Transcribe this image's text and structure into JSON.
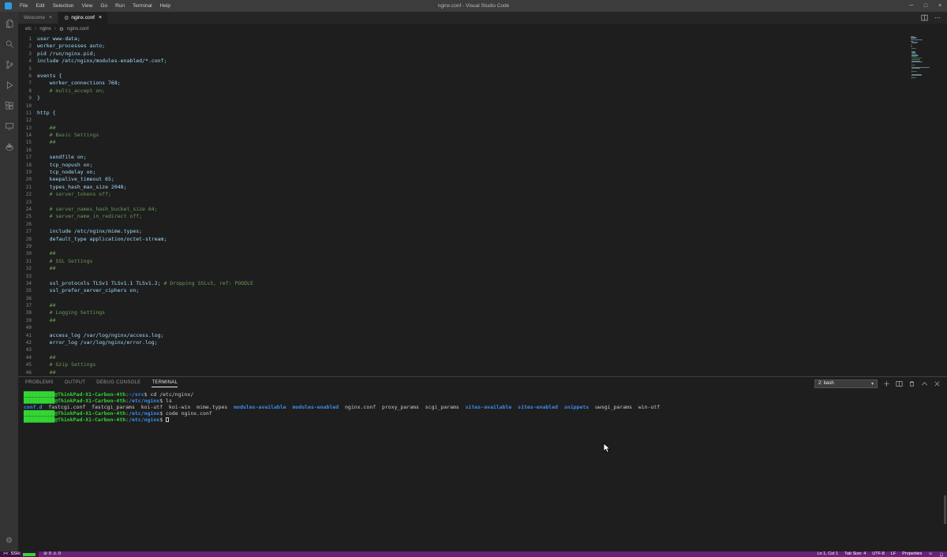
{
  "window": {
    "title": "nginx.conf - Visual Studio Code",
    "menu": [
      "File",
      "Edit",
      "Selection",
      "View",
      "Go",
      "Run",
      "Terminal",
      "Help"
    ],
    "controls": {
      "minimize": "─",
      "maximize": "□",
      "close": "×"
    }
  },
  "icons": {
    "gear": "⚙",
    "chevron_down": "▾",
    "more": "⋯",
    "remote": "><",
    "smiley": "☺"
  },
  "editor_tabs": [
    {
      "label": "Welcome",
      "close": "×"
    },
    {
      "label": "nginx.conf",
      "icon": "⚙",
      "close": "×"
    }
  ],
  "breadcrumb": {
    "items": [
      "etc",
      "nginx",
      "nginx.conf"
    ],
    "separator": "›"
  },
  "editor": {
    "lines": [
      {
        "n": 1,
        "s": [
          {
            "t": "user www-data;",
            "c": "code"
          }
        ]
      },
      {
        "n": 2,
        "s": [
          {
            "t": "worker_processes auto;",
            "c": "code"
          }
        ]
      },
      {
        "n": 3,
        "s": [
          {
            "t": "pid /run/nginx.pid;",
            "c": "code"
          }
        ]
      },
      {
        "n": 4,
        "s": [
          {
            "t": "include /etc/nginx/modules-enabled/*.conf;",
            "c": "code"
          }
        ]
      },
      {
        "n": 5,
        "s": []
      },
      {
        "n": 6,
        "s": [
          {
            "t": "events {",
            "c": "code"
          }
        ]
      },
      {
        "n": 7,
        "s": [
          {
            "t": "\tworker_connections 768;",
            "c": "code"
          }
        ]
      },
      {
        "n": 8,
        "s": [
          {
            "t": "\t# multi_accept on;",
            "c": "comment"
          }
        ]
      },
      {
        "n": 9,
        "s": [
          {
            "t": "}",
            "c": "code"
          }
        ]
      },
      {
        "n": 10,
        "s": []
      },
      {
        "n": 11,
        "s": [
          {
            "t": "http {",
            "c": "code"
          }
        ]
      },
      {
        "n": 12,
        "s": []
      },
      {
        "n": 13,
        "s": [
          {
            "t": "\t##",
            "c": "comment"
          }
        ]
      },
      {
        "n": 14,
        "s": [
          {
            "t": "\t# Basic Settings",
            "c": "comment"
          }
        ]
      },
      {
        "n": 15,
        "s": [
          {
            "t": "\t##",
            "c": "comment"
          }
        ]
      },
      {
        "n": 16,
        "s": []
      },
      {
        "n": 17,
        "s": [
          {
            "t": "\tsendfile on;",
            "c": "code"
          }
        ]
      },
      {
        "n": 18,
        "s": [
          {
            "t": "\ttcp_nopush on;",
            "c": "code"
          }
        ]
      },
      {
        "n": 19,
        "s": [
          {
            "t": "\ttcp_nodelay on;",
            "c": "code"
          }
        ]
      },
      {
        "n": 20,
        "s": [
          {
            "t": "\tkeepalive_timeout 65;",
            "c": "code"
          }
        ]
      },
      {
        "n": 21,
        "s": [
          {
            "t": "\ttypes_hash_max_size 2048;",
            "c": "code"
          }
        ]
      },
      {
        "n": 22,
        "s": [
          {
            "t": "\t# server_tokens off;",
            "c": "comment"
          }
        ]
      },
      {
        "n": 23,
        "s": []
      },
      {
        "n": 24,
        "s": [
          {
            "t": "\t# server_names_hash_bucket_size 64;",
            "c": "comment"
          }
        ]
      },
      {
        "n": 25,
        "s": [
          {
            "t": "\t# server_name_in_redirect off;",
            "c": "comment"
          }
        ]
      },
      {
        "n": 26,
        "s": []
      },
      {
        "n": 27,
        "s": [
          {
            "t": "\tinclude /etc/nginx/mime.types;",
            "c": "code"
          }
        ]
      },
      {
        "n": 28,
        "s": [
          {
            "t": "\tdefault_type application/octet-stream;",
            "c": "code"
          }
        ]
      },
      {
        "n": 29,
        "s": []
      },
      {
        "n": 30,
        "s": [
          {
            "t": "\t##",
            "c": "comment"
          }
        ]
      },
      {
        "n": 31,
        "s": [
          {
            "t": "\t# SSL Settings",
            "c": "comment"
          }
        ]
      },
      {
        "n": 32,
        "s": [
          {
            "t": "\t##",
            "c": "comment"
          }
        ]
      },
      {
        "n": 33,
        "s": []
      },
      {
        "n": 34,
        "s": [
          {
            "t": "\tssl_protocols TLSv1 TLSv1.1 TLSv1.2; ",
            "c": "code"
          },
          {
            "t": "# Dropping SSLv3, ref: POODLE",
            "c": "comment"
          }
        ]
      },
      {
        "n": 35,
        "s": [
          {
            "t": "\tssl_prefer_server_ciphers on;",
            "c": "code"
          }
        ]
      },
      {
        "n": 36,
        "s": []
      },
      {
        "n": 37,
        "s": [
          {
            "t": "\t##",
            "c": "comment"
          }
        ]
      },
      {
        "n": 38,
        "s": [
          {
            "t": "\t# Logging Settings",
            "c": "comment"
          }
        ]
      },
      {
        "n": 39,
        "s": [
          {
            "t": "\t##",
            "c": "comment"
          }
        ]
      },
      {
        "n": 40,
        "s": []
      },
      {
        "n": 41,
        "s": [
          {
            "t": "\taccess_log /var/log/nginx/access.log;",
            "c": "code"
          }
        ]
      },
      {
        "n": 42,
        "s": [
          {
            "t": "\terror_log /var/log/nginx/error.log;",
            "c": "code"
          }
        ]
      },
      {
        "n": 43,
        "s": []
      },
      {
        "n": 44,
        "s": [
          {
            "t": "\t##",
            "c": "comment"
          }
        ]
      },
      {
        "n": 45,
        "s": [
          {
            "t": "\t# Gzip Settings",
            "c": "comment"
          }
        ]
      },
      {
        "n": 46,
        "s": [
          {
            "t": "\t##",
            "c": "comment"
          }
        ]
      }
    ]
  },
  "panel": {
    "tabs": [
      "PROBLEMS",
      "OUTPUT",
      "DEBUG CONSOLE",
      "TERMINAL"
    ],
    "active_tab": "TERMINAL",
    "shell_selector": "2: bash",
    "terminal_lines": [
      {
        "s": [
          {
            "t": "██████████@ThinkPad-X1-Carbon-4th",
            "c": "prompt"
          },
          {
            "t": ":",
            "c": "plain"
          },
          {
            "t": "~/src",
            "c": "path"
          },
          {
            "t": "$ ",
            "c": "plain"
          },
          {
            "t": "cd /etc/nginx/",
            "c": "plain"
          }
        ]
      },
      {
        "s": [
          {
            "t": "██████████@ThinkPad-X1-Carbon-4th",
            "c": "prompt"
          },
          {
            "t": ":",
            "c": "plain"
          },
          {
            "t": "/etc/nginx",
            "c": "path"
          },
          {
            "t": "$ ",
            "c": "plain"
          },
          {
            "t": "ls",
            "c": "plain"
          }
        ]
      },
      {
        "s": [
          {
            "t": "conf.d",
            "c": "dir"
          },
          {
            "t": "  fastcgi.conf  fastcgi_params  koi-utf  koi-win  mime.types  ",
            "c": "plain"
          },
          {
            "t": "modules-available",
            "c": "dir"
          },
          {
            "t": "  ",
            "c": "plain"
          },
          {
            "t": "modules-enabled",
            "c": "dir"
          },
          {
            "t": "  nginx.conf  proxy_params  scgi_params  ",
            "c": "plain"
          },
          {
            "t": "sites-available",
            "c": "dir"
          },
          {
            "t": "  ",
            "c": "plain"
          },
          {
            "t": "sites-enabled",
            "c": "dir"
          },
          {
            "t": "  ",
            "c": "plain"
          },
          {
            "t": "snippets",
            "c": "dir"
          },
          {
            "t": "  uwsgi_params  win-utf",
            "c": "plain"
          }
        ]
      },
      {
        "s": [
          {
            "t": "██████████@ThinkPad-X1-Carbon-4th",
            "c": "prompt"
          },
          {
            "t": ":",
            "c": "plain"
          },
          {
            "t": "/etc/nginx",
            "c": "path"
          },
          {
            "t": "$ ",
            "c": "plain"
          },
          {
            "t": "code nginx.conf",
            "c": "plain"
          }
        ]
      },
      {
        "s": [
          {
            "t": "██████████@ThinkPad-X1-Carbon-4th",
            "c": "prompt"
          },
          {
            "t": ":",
            "c": "plain"
          },
          {
            "t": "/etc/nginx",
            "c": "path"
          },
          {
            "t": "$ ",
            "c": "plain"
          },
          {
            "t": "",
            "c": "cursor"
          }
        ]
      }
    ]
  },
  "status_bar": {
    "remote_label": "SSH:",
    "errors_icon": "⊘",
    "errors": "0",
    "warnings_icon": "⚠",
    "warnings": "0",
    "cursor_position": "Ln 1, Col 1",
    "indentation": "Tab Size: 4",
    "encoding": "UTF-8",
    "eol": "LF",
    "language": "Properties"
  },
  "colors": {
    "status_bar": "#68217a",
    "prompt_green": "#33d633",
    "path_blue": "#3b8eea",
    "comment_green": "#6a9955",
    "code_blue": "#9cdcfe",
    "titlebar": "#3c3c3c",
    "activity_bar": "#333333",
    "editor_bg": "#1e1e1e"
  }
}
